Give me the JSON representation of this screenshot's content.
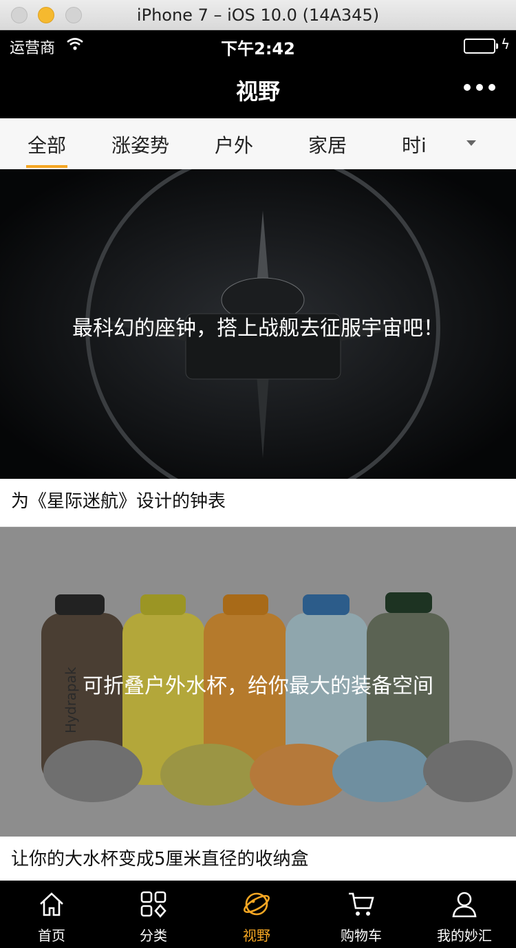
{
  "window": {
    "title": "iPhone 7 – iOS 10.0 (14A345)"
  },
  "status_bar": {
    "carrier": "运营商",
    "time": "下午2:42",
    "battery_level": 1.0
  },
  "nav": {
    "title": "视野"
  },
  "tabs": {
    "items": [
      {
        "label": "全部",
        "active": true
      },
      {
        "label": "涨姿势"
      },
      {
        "label": "户外"
      },
      {
        "label": "家居"
      },
      {
        "label": "时i"
      }
    ]
  },
  "feed": {
    "items": [
      {
        "overlay": "最科幻的座钟，搭上战舰去征服宇宙吧！",
        "caption": "为《星际迷航》设计的钟表"
      },
      {
        "overlay": "可折叠户外水杯，给你最大的装备空间",
        "caption": "让你的大水杯变成5厘米直径的收纳盒"
      }
    ]
  },
  "bottom_tabs": {
    "items": [
      {
        "label": "首页",
        "icon": "home-icon"
      },
      {
        "label": "分类",
        "icon": "category-icon"
      },
      {
        "label": "视野",
        "icon": "planet-icon",
        "active": true
      },
      {
        "label": "购物车",
        "icon": "cart-icon"
      },
      {
        "label": "我的妙汇",
        "icon": "user-icon"
      }
    ]
  },
  "colors": {
    "accent": "#f5a623",
    "bar_bg": "#000000",
    "tab_bg": "#f7f7f7"
  },
  "bottle_logo": "Hydrapak"
}
